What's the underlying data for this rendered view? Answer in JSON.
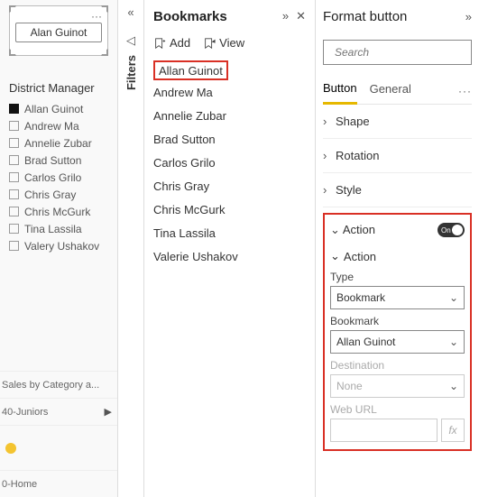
{
  "canvas": {
    "button_text": "Alan Guinot",
    "slicer_title": "District Manager",
    "slicer_items": [
      {
        "label": "Allan Guinot",
        "checked": true
      },
      {
        "label": "Andrew Ma",
        "checked": false
      },
      {
        "label": "Annelie Zubar",
        "checked": false
      },
      {
        "label": "Brad Sutton",
        "checked": false
      },
      {
        "label": "Carlos Grilo",
        "checked": false
      },
      {
        "label": "Chris Gray",
        "checked": false
      },
      {
        "label": "Chris McGurk",
        "checked": false
      },
      {
        "label": "Tina Lassila",
        "checked": false
      },
      {
        "label": "Valery Ushakov",
        "checked": false
      }
    ],
    "footer1": "Sales by Category a...",
    "footer2": "40-Juniors",
    "footer3": "0-Home"
  },
  "filters": {
    "label": "Filters"
  },
  "bookmarks": {
    "title": "Bookmarks",
    "add_label": "Add",
    "view_label": "View",
    "items": [
      "Allan Guinot",
      "Andrew Ma",
      "Annelie Zubar",
      "Brad Sutton",
      "Carlos Grilo",
      "Chris Gray",
      "Chris McGurk",
      "Tina Lassila",
      "Valerie Ushakov"
    ],
    "selected_index": 0
  },
  "format": {
    "title": "Format button",
    "search_placeholder": "Search",
    "tabs": {
      "button": "Button",
      "general": "General"
    },
    "sections": {
      "shape": "Shape",
      "rotation": "Rotation",
      "style": "Style"
    },
    "action": {
      "head": "Action",
      "toggle_text": "On",
      "sub": "Action",
      "type_label": "Type",
      "type_value": "Bookmark",
      "bookmark_label": "Bookmark",
      "bookmark_value": "Allan Guinot",
      "destination_label": "Destination",
      "destination_value": "None",
      "weburl_label": "Web URL",
      "fx": "fx"
    }
  }
}
